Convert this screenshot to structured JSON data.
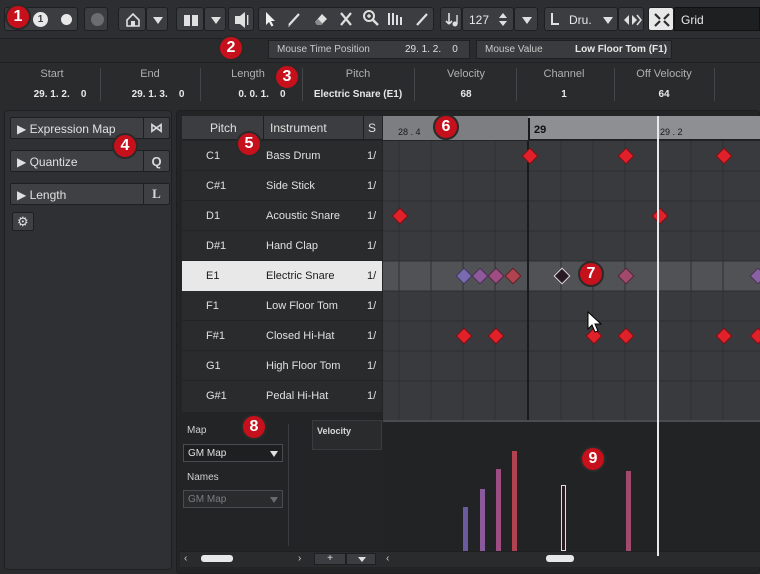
{
  "toolbar": {
    "record_group": "record-buttons",
    "tempo": "127",
    "quantize_label": "Dru.",
    "grid_label": "Grid"
  },
  "status": {
    "mouse_time_label": "Mouse Time Position",
    "mouse_time_value": "29. 1. 2.    0",
    "mouse_value_label": "Mouse Value",
    "mouse_value_value": "Low Floor Tom (F1)"
  },
  "infoline": {
    "start_label": "Start",
    "start_value": "29. 1. 2.    0",
    "end_label": "End",
    "end_value": "29. 1. 3.    0",
    "length_label": "Length",
    "length_value": "0. 0. 1.    0",
    "pitch_label": "Pitch",
    "pitch_value": "Electric Snare (E1)",
    "velocity_label": "Velocity",
    "velocity_value": "68",
    "channel_label": "Channel",
    "channel_value": "1",
    "offvel_label": "Off Velocity",
    "offvel_value": "64"
  },
  "inspector": {
    "expression_map": "Expression Map",
    "quantize": "Quantize",
    "quantize_key": "Q",
    "length": "Length",
    "length_key": "L"
  },
  "drum_list": {
    "col_pitch": "Pitch",
    "col_instrument": "Instrument",
    "col_s": "S",
    "rows": [
      {
        "pitch": "C1",
        "instrument": "Bass Drum",
        "q": "1/"
      },
      {
        "pitch": "C#1",
        "instrument": "Side Stick",
        "q": "1/"
      },
      {
        "pitch": "D1",
        "instrument": "Acoustic Snare",
        "q": "1/"
      },
      {
        "pitch": "D#1",
        "instrument": "Hand Clap",
        "q": "1/"
      },
      {
        "pitch": "E1",
        "instrument": "Electric Snare",
        "q": "1/"
      },
      {
        "pitch": "F1",
        "instrument": "Low Floor Tom",
        "q": "1/"
      },
      {
        "pitch": "F#1",
        "instrument": "Closed Hi-Hat",
        "q": "1/"
      },
      {
        "pitch": "G1",
        "instrument": "High Floor Tom",
        "q": "1/"
      },
      {
        "pitch": "G#1",
        "instrument": "Pedal Hi-Hat",
        "q": "1/"
      }
    ]
  },
  "map_section": {
    "map_label": "Map",
    "map_value": "GM Map",
    "names_label": "Names",
    "names_value": "GM Map",
    "velocity_label": "Velocity"
  },
  "ruler": {
    "left_label": "28 . 4",
    "bar_label": "29",
    "right_label": "29 . 2"
  },
  "markers": [
    "1",
    "2",
    "3",
    "4",
    "5",
    "6",
    "7",
    "8",
    "9"
  ],
  "colors": {
    "note_red": "#e0212a",
    "note_purple": "#7a6ab0",
    "selected_row": "#e8e8e8"
  }
}
